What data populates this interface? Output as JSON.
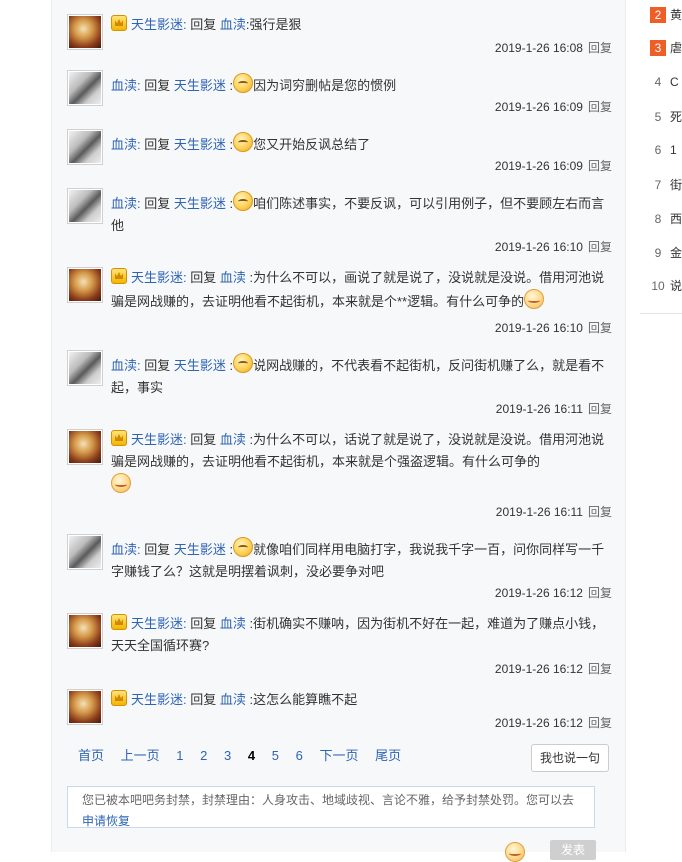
{
  "replies": [
    {
      "user": "天生影迷",
      "crown": true,
      "avatar": "warm",
      "prefix_emoji": "",
      "text_pre": "回复",
      "target": "血渎",
      "text": ":强行是狠",
      "end_emoji": "",
      "time": "2019-1-26 16:08",
      "reply": "回复"
    },
    {
      "user": "血渎",
      "crown": false,
      "avatar": "gray",
      "text_pre": "回复",
      "target": "天生影迷",
      "text": " :",
      "prefix_emoji": "smile",
      "body": "因为词穷删帖是您的惯例",
      "time": "2019-1-26 16:09",
      "reply": "回复"
    },
    {
      "user": "血渎",
      "crown": false,
      "avatar": "gray",
      "text_pre": "回复",
      "target": "天生影迷",
      "text": " :",
      "prefix_emoji": "smile",
      "body": "您又开始反讽总结了",
      "time": "2019-1-26 16:09",
      "reply": "回复"
    },
    {
      "user": "血渎",
      "crown": false,
      "avatar": "gray",
      "text_pre": "回复",
      "target": "天生影迷",
      "text": " :",
      "prefix_emoji": "smile",
      "body": "咱们陈述事实，不要反讽，可以引用例子，但不要顾左右而言他",
      "time": "2019-1-26 16:10",
      "reply": "回复"
    },
    {
      "user": "天生影迷",
      "crown": true,
      "avatar": "warm",
      "text_pre": "回复",
      "target": "血渎",
      "text": " :为什么不可以，画说了就是说了，没说就是没说。借用河池说骗是网战赚的，去证明他看不起街机，本来就是个**逻辑。有什么可争的",
      "end_emoji": "shy",
      "time": "2019-1-26 16:10",
      "reply": "回复"
    },
    {
      "user": "血渎",
      "crown": false,
      "avatar": "gray",
      "text_pre": "回复",
      "target": "天生影迷",
      "text": " :",
      "prefix_emoji": "smile",
      "body": "说网战赚的，不代表看不起街机，反问街机赚了么，就是看不起，事实",
      "time": "2019-1-26 16:11",
      "reply": "回复"
    },
    {
      "user": "天生影迷",
      "crown": true,
      "avatar": "warm",
      "text_pre": "回复",
      "target": "血渎",
      "text": " :为什么不可以，话说了就是说了，没说就是没说。借用河池说骗是网战赚的，去证明他看不起街机，本来就是个强盗逻辑。有什么可争的",
      "end_emoji": "shy",
      "time": "2019-1-26 16:11",
      "reply": "回复"
    },
    {
      "user": "血渎",
      "crown": false,
      "avatar": "gray",
      "text_pre": "回复",
      "target": "天生影迷",
      "text": " :",
      "prefix_emoji": "smile",
      "body": "就像咱们同样用电脑打字，我说我千字一百，问你同样写一千字赚钱了么？这就是明摆着讽刺，没必要争对吧",
      "time": "2019-1-26 16:12",
      "reply": "回复"
    },
    {
      "user": "天生影迷",
      "crown": true,
      "avatar": "warm",
      "text_pre": "回复",
      "target": "血渎",
      "text": " :街机确实不赚呐，因为街机不好在一起，难道为了赚点小钱，天天全国循环赛?",
      "time": "2019-1-26 16:12",
      "reply": "回复"
    },
    {
      "user": "天生影迷",
      "crown": true,
      "avatar": "warm",
      "text_pre": "回复",
      "target": "血渎",
      "text": " :这怎么能算瞧不起",
      "time": "2019-1-26 16:12",
      "reply": "回复"
    }
  ],
  "pagination": {
    "first": "首页",
    "prev": "上一页",
    "pages": [
      "1",
      "2",
      "3",
      "4",
      "5",
      "6"
    ],
    "current": "4",
    "next": "下一页",
    "last": "尾页"
  },
  "say_button": "我也说一句",
  "ban_notice": {
    "text": "您已被本吧吧务封禁，封禁理由：人身攻击、地域歧视、言论不雅，给予封禁处罚。您可以去",
    "link": "申请恢复"
  },
  "publish_button": "发表",
  "sidebar_ranks": [
    {
      "num": "2",
      "hot": true,
      "title": "黄"
    },
    {
      "num": "3",
      "hot": true,
      "title": "虐"
    },
    {
      "num": "4",
      "hot": false,
      "title": "C"
    },
    {
      "num": "5",
      "hot": false,
      "title": "死"
    },
    {
      "num": "6",
      "hot": false,
      "title": "1"
    },
    {
      "num": "7",
      "hot": false,
      "title": "街"
    },
    {
      "num": "8",
      "hot": false,
      "title": "西"
    },
    {
      "num": "9",
      "hot": false,
      "title": "金"
    },
    {
      "num": "10",
      "hot": false,
      "title": "说"
    }
  ],
  "colors": {
    "link": "#2d64b3",
    "hot_rank": "#f05e27",
    "panel_bg": "#f7f8fa"
  }
}
